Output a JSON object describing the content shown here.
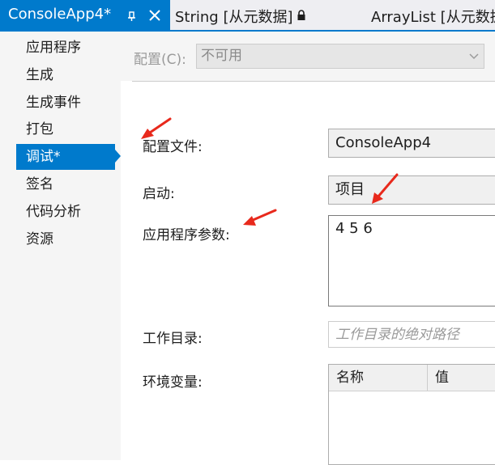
{
  "tabs": {
    "active": "ConsoleApp4*",
    "string": "String [从元数据]",
    "arraylist": "ArrayList [从元数据]"
  },
  "sidebar": {
    "items": [
      {
        "label": "应用程序"
      },
      {
        "label": "生成"
      },
      {
        "label": "生成事件"
      },
      {
        "label": "打包"
      },
      {
        "label": "调试*"
      },
      {
        "label": "签名"
      },
      {
        "label": "代码分析"
      },
      {
        "label": "资源"
      }
    ],
    "selected_index": 4
  },
  "config": {
    "label": "配置(C):",
    "value": "不可用"
  },
  "form": {
    "profile_label": "配置文件:",
    "profile_value": "ConsoleApp4",
    "launch_label": "启动:",
    "launch_value": "项目",
    "args_label": "应用程序参数:",
    "args_value": "4 5 6",
    "workdir_label": "工作目录:",
    "workdir_placeholder": "工作目录的绝对路径",
    "env_label": "环境变量:",
    "env_columns": [
      "名称",
      "值"
    ]
  },
  "colors": {
    "accent": "#007acc",
    "arrow": "#e8291c"
  },
  "icons": {
    "pin": "pin-icon",
    "close": "close-icon",
    "lock": "lock-icon"
  }
}
